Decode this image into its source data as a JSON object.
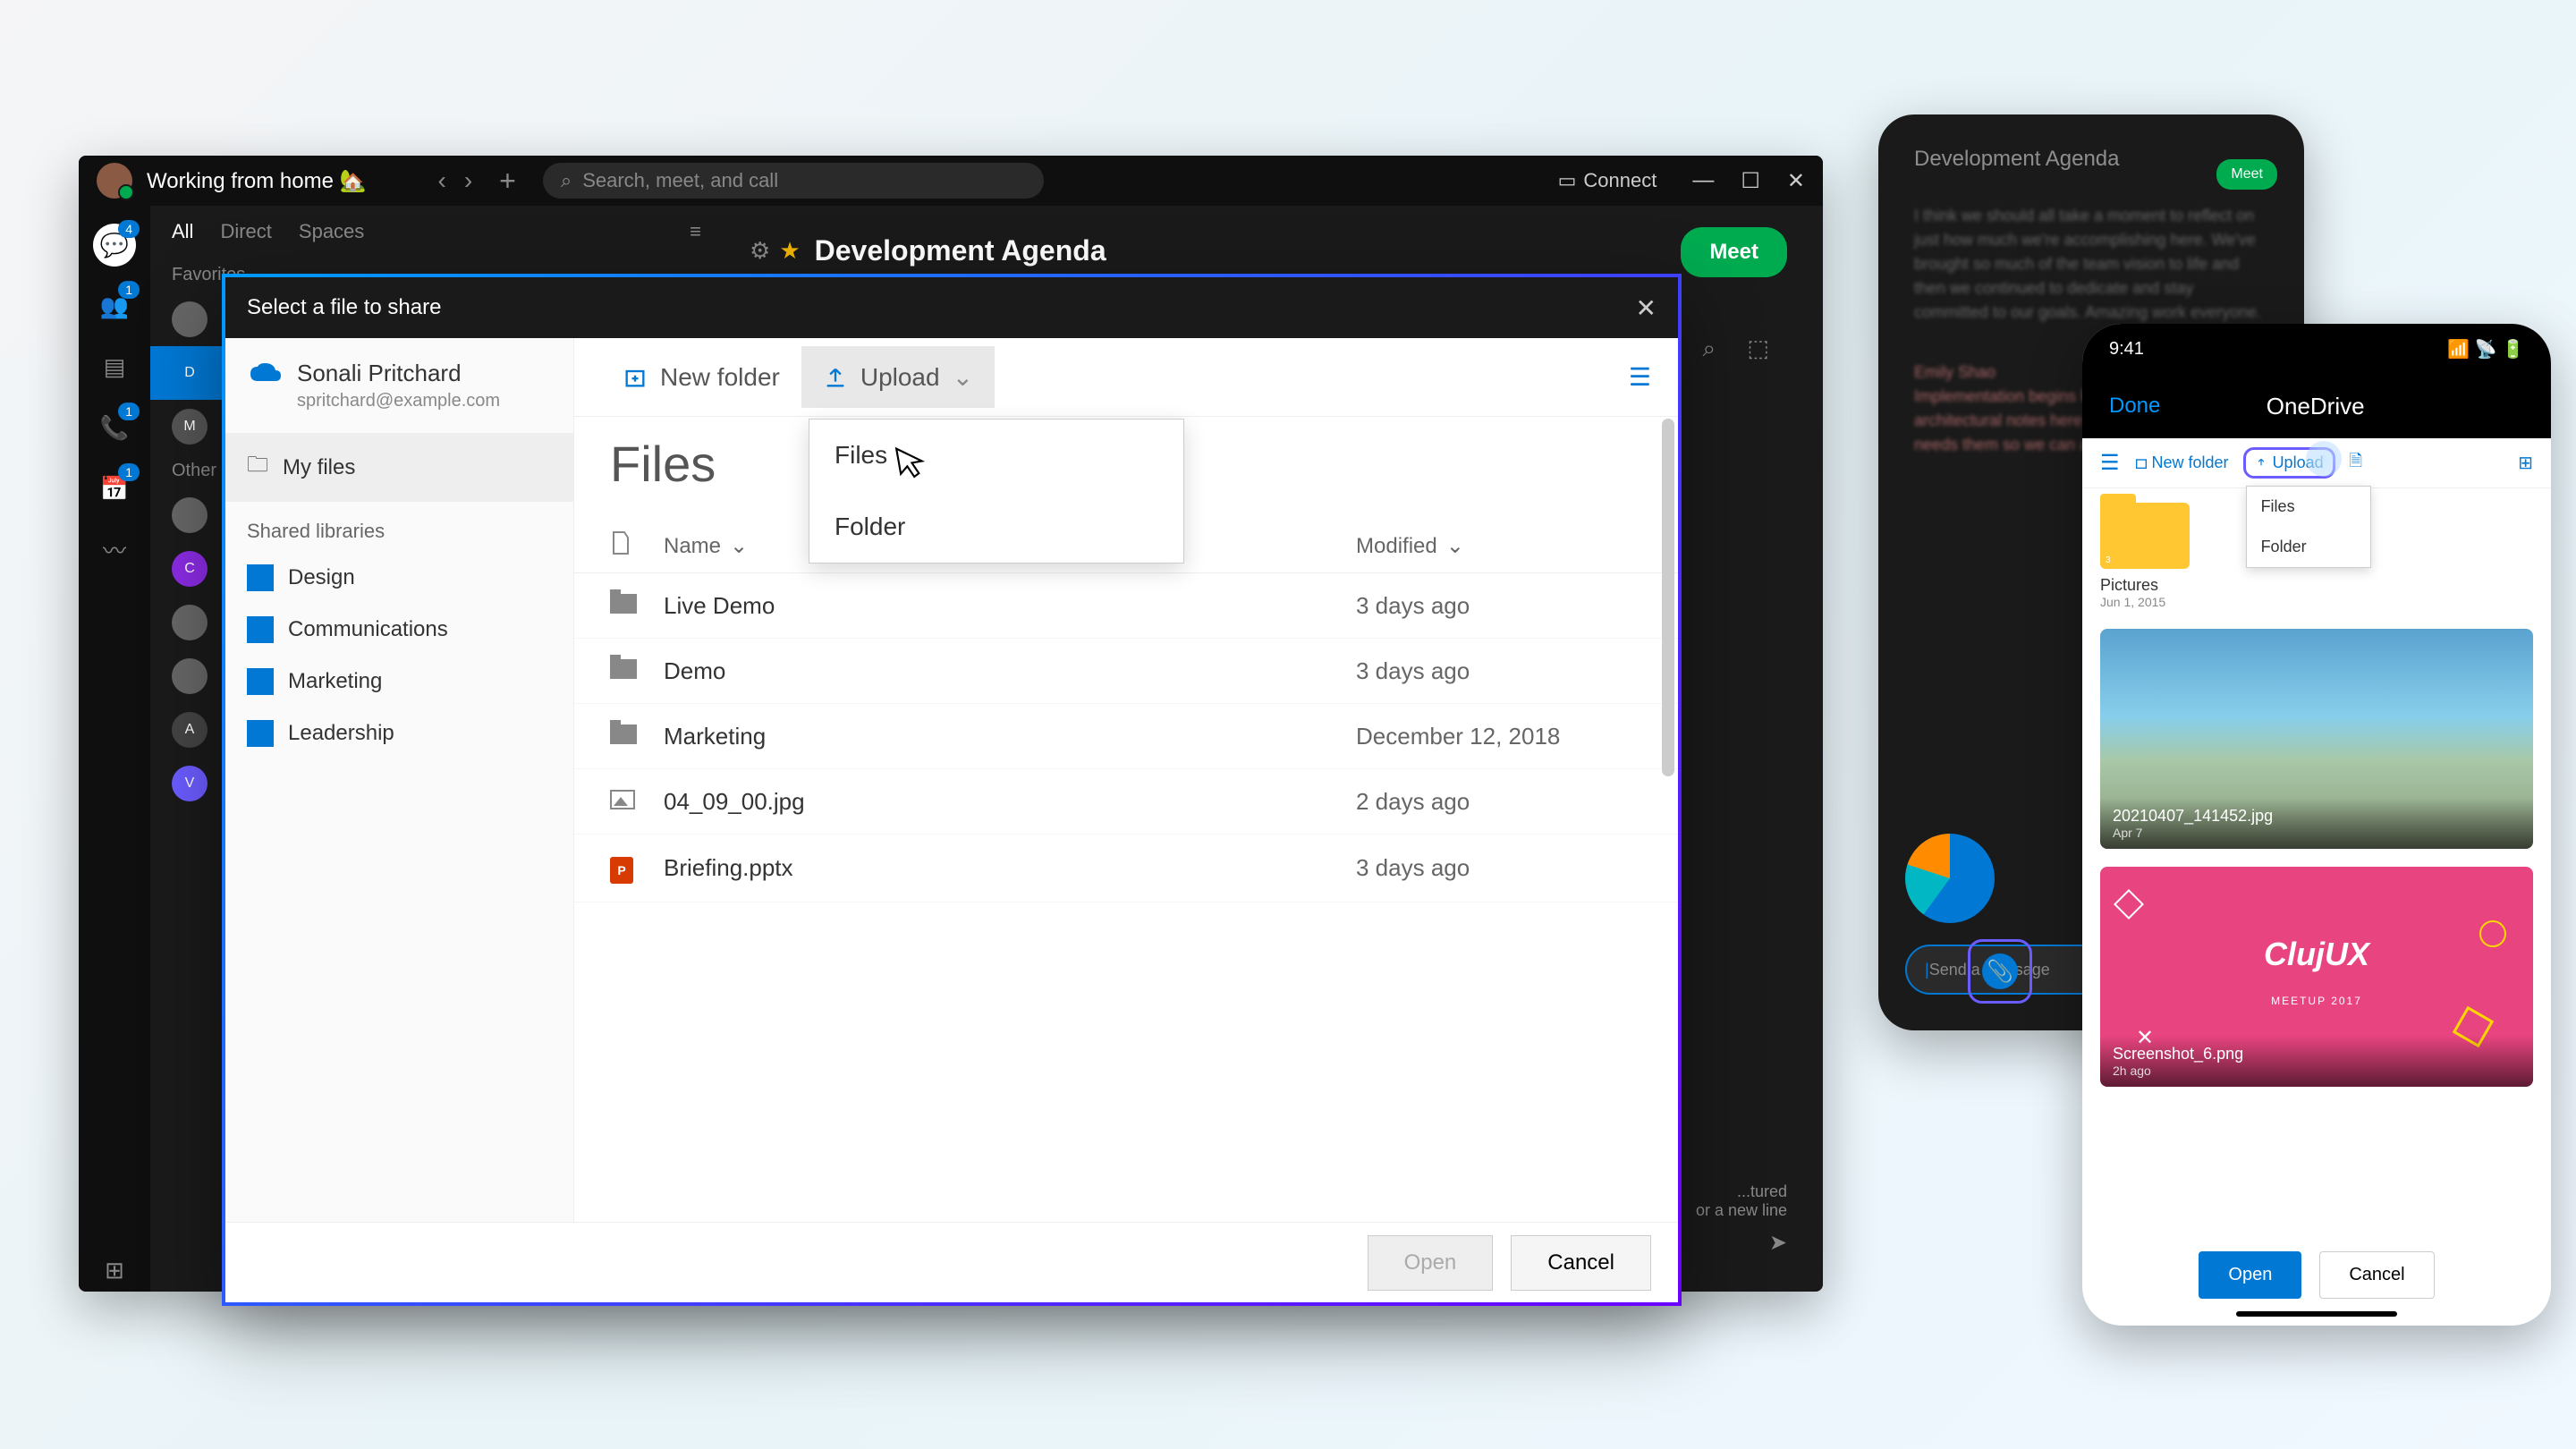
{
  "webex": {
    "status": "Working from home 🏡",
    "search_placeholder": "Search, meet, and call",
    "connect": "Connect",
    "nav_tabs": [
      "All",
      "Direct",
      "Spaces"
    ],
    "favorites": "Favorites",
    "other": "Other",
    "content_title": "Development Agenda",
    "meet": "Meet",
    "hint": "...tured",
    "newline_hint": "or a new line",
    "rail_badges": {
      "chat": "4",
      "teams": "1",
      "calls": "1",
      "cal": "1"
    },
    "sidebar_letters": [
      "D",
      "M",
      "C",
      "A",
      "V"
    ]
  },
  "modal": {
    "title": "Select a file to share",
    "user_name": "Sonali Pritchard",
    "user_email": "spritchard@example.com",
    "my_files": "My files",
    "shared_libraries": "Shared libraries",
    "libraries": [
      "Design",
      "Communications",
      "Marketing",
      "Leadership"
    ],
    "new_folder": "New folder",
    "upload": "Upload",
    "dropdown": {
      "files": "Files",
      "folder": "Folder"
    },
    "files_title": "Files",
    "col_name": "Name",
    "col_modified": "Modified",
    "rows": [
      {
        "icon": "folder",
        "name": "Live Demo",
        "modified": "3 days ago"
      },
      {
        "icon": "folder",
        "name": "Demo",
        "modified": "3 days ago"
      },
      {
        "icon": "folder",
        "name": "Marketing",
        "modified": "December 12, 2018"
      },
      {
        "icon": "image",
        "name": "04_09_00.jpg",
        "modified": "2 days ago"
      },
      {
        "icon": "ppt",
        "name": "Briefing.pptx",
        "modified": "3 days ago"
      }
    ],
    "open": "Open",
    "cancel": "Cancel"
  },
  "phone_dark": {
    "title": "Development Agenda",
    "meet": "Meet",
    "msg_placeholder": "Send a message"
  },
  "phone_light": {
    "time": "9:41",
    "done": "Done",
    "title": "OneDrive",
    "new_folder": "New folder",
    "upload": "Upload",
    "dd_files": "Files",
    "dd_folder": "Folder",
    "folder_name": "Pictures",
    "folder_date": "Jun 1, 2015",
    "img1_name": "20210407_141452.jpg",
    "img1_date": "Apr 7",
    "img2_name": "Screenshot_6.png",
    "img2_date": "2h ago",
    "cluj": "ClujUX",
    "cluj_sub": "MEETUP 2017",
    "open": "Open",
    "cancel": "Cancel"
  }
}
